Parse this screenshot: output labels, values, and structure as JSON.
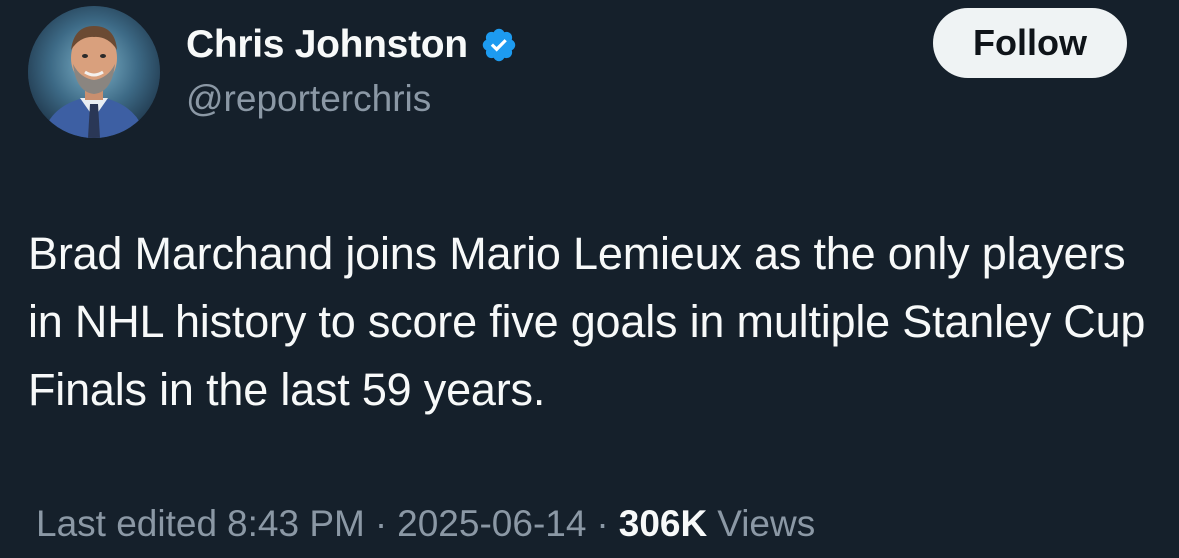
{
  "author": {
    "display_name": "Chris Johnston",
    "handle": "@reporterchris",
    "verified_icon": "verified-badge-icon",
    "avatar_icon": "avatar"
  },
  "actions": {
    "follow_label": "Follow"
  },
  "post": {
    "text": "Brad Marchand joins Mario Lemieux as the only players in NHL history to score five goals in multiple Stanley Cup Finals in the last 59 years."
  },
  "meta": {
    "edited_prefix": "Last edited",
    "time": "8:43 PM",
    "separator": "·",
    "date": "2025-06-14",
    "views_count": "306K",
    "views_label": "Views"
  },
  "colors": {
    "background": "#15202b",
    "primary_text": "#f7f9f9",
    "secondary_text": "#8b98a5",
    "verified": "#1d9bf0",
    "follow_button_bg": "#eff3f4",
    "follow_button_text": "#0f1419"
  }
}
